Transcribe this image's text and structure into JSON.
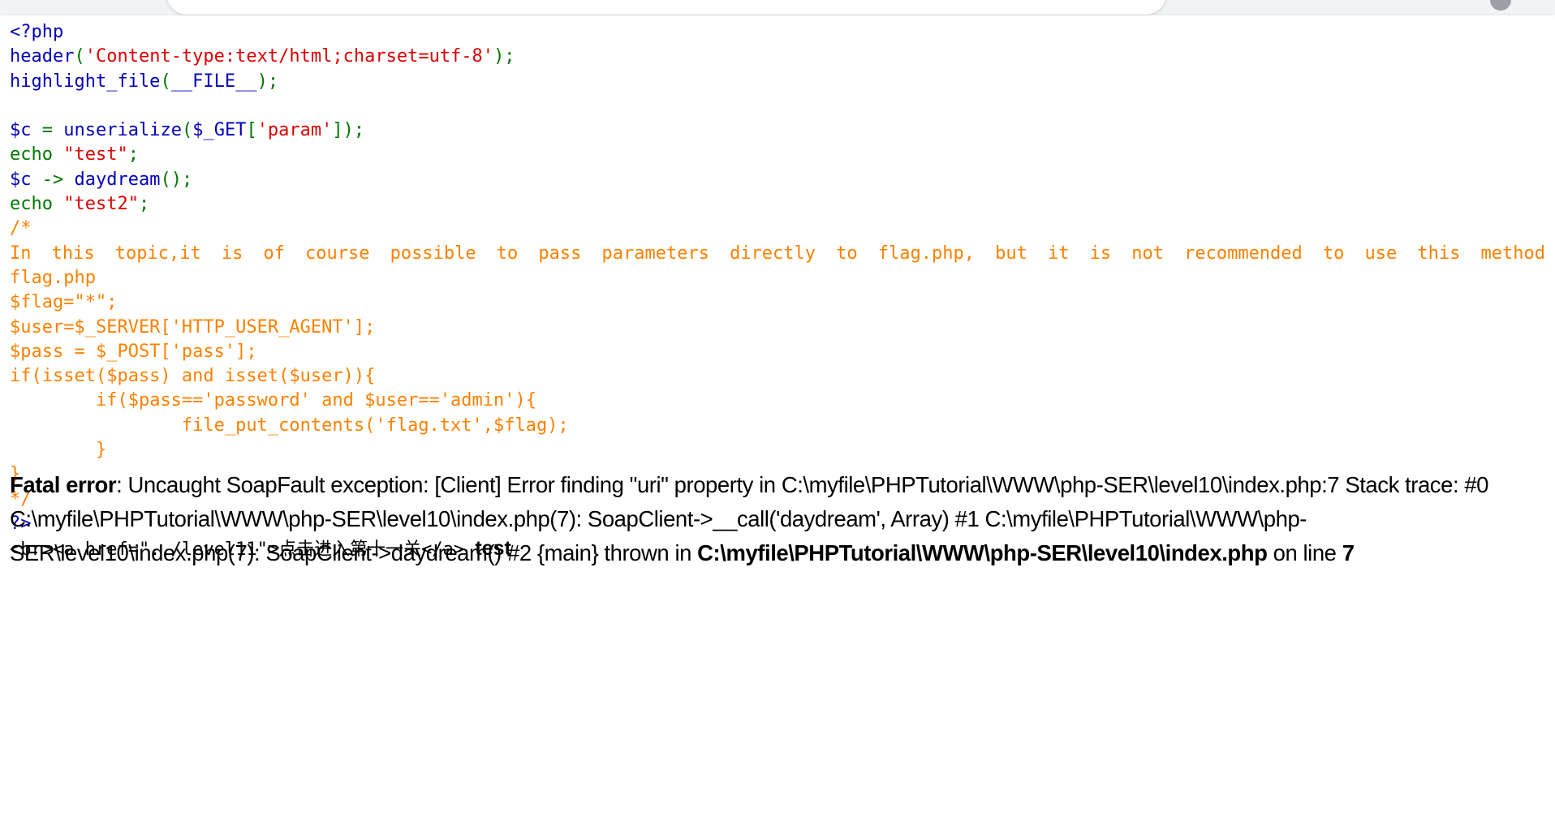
{
  "browser": {
    "chrome_visible": true,
    "avatar_icon": "profile-avatar-icon"
  },
  "colors": {
    "php_keyword": "#0000BB",
    "php_string": "#DD0000",
    "php_comment": "#FF8000",
    "php_default": "#007700",
    "html_text": "#000000",
    "page_background": "#ffffff",
    "chrome_background": "#f1f3f4"
  },
  "code": {
    "language": "php",
    "lines": [
      {
        "id": "l1",
        "indent": 0,
        "segments": [
          {
            "cls": "kw",
            "t": "<?php"
          }
        ]
      },
      {
        "id": "l2",
        "indent": 0,
        "segments": [
          {
            "cls": "kw",
            "t": "header"
          },
          {
            "cls": "def",
            "t": "("
          },
          {
            "cls": "str",
            "t": "'Content-type:text/html;charset=utf-8'"
          },
          {
            "cls": "def",
            "t": ");"
          }
        ]
      },
      {
        "id": "l3",
        "indent": 0,
        "segments": [
          {
            "cls": "kw",
            "t": "highlight_file"
          },
          {
            "cls": "def",
            "t": "("
          },
          {
            "cls": "kw",
            "t": "__FILE__"
          },
          {
            "cls": "def",
            "t": ");"
          }
        ]
      },
      {
        "id": "l4",
        "indent": 0,
        "segments": [
          {
            "cls": "def",
            "t": ""
          }
        ]
      },
      {
        "id": "l5",
        "indent": 0,
        "segments": [
          {
            "cls": "kw",
            "t": "$c"
          },
          {
            "cls": "def",
            "t": " = "
          },
          {
            "cls": "kw",
            "t": "unserialize"
          },
          {
            "cls": "def",
            "t": "("
          },
          {
            "cls": "kw",
            "t": "$_GET"
          },
          {
            "cls": "def",
            "t": "["
          },
          {
            "cls": "str",
            "t": "'param'"
          },
          {
            "cls": "def",
            "t": "]);"
          }
        ]
      },
      {
        "id": "l6",
        "indent": 0,
        "segments": [
          {
            "cls": "def",
            "t": "echo "
          },
          {
            "cls": "str",
            "t": "\"test\""
          },
          {
            "cls": "def",
            "t": ";"
          }
        ]
      },
      {
        "id": "l7",
        "indent": 0,
        "segments": [
          {
            "cls": "kw",
            "t": "$c"
          },
          {
            "cls": "def",
            "t": " -> "
          },
          {
            "cls": "kw",
            "t": "daydream"
          },
          {
            "cls": "def",
            "t": "();"
          }
        ]
      },
      {
        "id": "l8",
        "indent": 0,
        "segments": [
          {
            "cls": "def",
            "t": "echo "
          },
          {
            "cls": "str",
            "t": "\"test2\""
          },
          {
            "cls": "def",
            "t": ";"
          }
        ]
      },
      {
        "id": "l9",
        "indent": 0,
        "segments": [
          {
            "cls": "cmt",
            "t": "/*"
          }
        ]
      },
      {
        "id": "l10",
        "indent": 0,
        "justify": true,
        "segments": [
          {
            "cls": "cmt",
            "t": "In this topic,it is of course possible to pass parameters directly to flag.php, but it is not recommended to use this method"
          }
        ]
      },
      {
        "id": "l11",
        "indent": 0,
        "segments": [
          {
            "cls": "cmt",
            "t": "flag.php"
          }
        ]
      },
      {
        "id": "l12",
        "indent": 0,
        "segments": [
          {
            "cls": "cmt",
            "t": "$flag=\"*\";"
          }
        ]
      },
      {
        "id": "l13",
        "indent": 0,
        "segments": [
          {
            "cls": "cmt",
            "t": "$user=$_SERVER['HTTP_USER_AGENT'];"
          }
        ]
      },
      {
        "id": "l14",
        "indent": 0,
        "segments": [
          {
            "cls": "cmt",
            "t": "$pass = $_POST['pass'];"
          }
        ]
      },
      {
        "id": "l15",
        "indent": 0,
        "segments": [
          {
            "cls": "cmt",
            "t": "if(isset($pass) and isset($user)){"
          }
        ]
      },
      {
        "id": "l16",
        "indent": 0,
        "segments": [
          {
            "cls": "cmt",
            "t": "        if($pass=='password' and $user=='admin'){"
          }
        ]
      },
      {
        "id": "l17",
        "indent": 0,
        "segments": [
          {
            "cls": "cmt",
            "t": "                file_put_contents('flag.txt',$flag);"
          }
        ]
      },
      {
        "id": "l18",
        "indent": 0,
        "segments": [
          {
            "cls": "cmt",
            "t": "        }"
          }
        ]
      },
      {
        "id": "l19",
        "indent": 0,
        "segments": [
          {
            "cls": "cmt",
            "t": "}"
          }
        ]
      },
      {
        "id": "l20",
        "indent": 0,
        "segments": [
          {
            "cls": "cmt",
            "t": "*/"
          }
        ]
      },
      {
        "id": "l21",
        "indent": 0,
        "segments": [
          {
            "cls": "kw",
            "t": "?>"
          }
        ]
      },
      {
        "id": "l22",
        "indent": 0,
        "segments": [
          {
            "cls": "html",
            "t": "<br><a href=\"../level11\">点击进入第十一关</a>"
          }
        ]
      }
    ]
  },
  "echo_output": {
    "text": "test"
  },
  "fatal_error": {
    "label": "Fatal error",
    "label_sep": ": ",
    "message_part1": "Uncaught SoapFault exception: [Client] Error finding \"uri\" property in C:\\myfile\\PHPTutorial\\WWW\\php-SER\\level10\\index.php:7 Stack trace: #0 C:\\myfile\\PHPTutorial\\WWW\\php-SER\\level10\\index.php(7): SoapClient->__call('daydream', Array) #1 C:\\myfile\\PHPTutorial\\WWW\\php-SER\\level10\\index.php(7): SoapClient->daydream() #2 {main} thrown in ",
    "file_path": "C:\\myfile\\PHPTutorial\\WWW\\php-SER\\level10\\index.php",
    "on_line_label": " on line ",
    "line_number": "7"
  }
}
